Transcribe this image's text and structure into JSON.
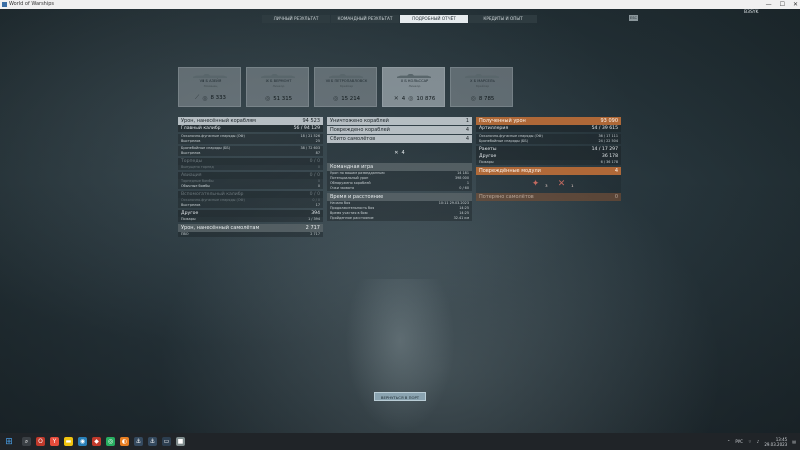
{
  "window": {
    "title": "World of Warships",
    "minimize": "—",
    "maximize": "☐",
    "close": "✕"
  },
  "tabs": [
    {
      "label": "ЛИЧНЫЙ РЕЗУЛЬТАТ"
    },
    {
      "label": "КОМАНДНЫЙ РЕЗУЛЬТАТ"
    },
    {
      "label": "ПОДРОБНЫЙ ОТЧЁТ"
    },
    {
      "label": "КРЕДИТЫ И ОПЫТ"
    }
  ],
  "exit_label": "ESC",
  "username": "B3SYK",
  "ships": [
    {
      "name": "Ⅷ Б АЗЕЙЯ",
      "desc": "Эсминец",
      "kills": "",
      "damage": "8 333",
      "icon": "torpedo-icon"
    },
    {
      "name": "Ⅸ Б ВЕРМОНТ",
      "desc": "Линкор",
      "kills": "",
      "damage": "51 315",
      "icon": "binoculars-icon"
    },
    {
      "name": "Ⅶ Б ПЕТРОПАВЛОВСК",
      "desc": "Крейсер",
      "kills": "",
      "damage": "15 214",
      "icon": "binoculars-icon"
    },
    {
      "name": "Ⅹ Б КОЛЬССАР",
      "desc": "Линкор",
      "kills": "4",
      "damage": "10 876",
      "icon": "binoculars-icon"
    },
    {
      "name": "Ⅹ Б МАРСЕЛЬ",
      "desc": "Крейсер",
      "kills": "",
      "damage": "8 785",
      "icon": "binoculars-icon"
    }
  ],
  "left": {
    "damage_ships": {
      "label": "Урон, нанесённый кораблям",
      "value": "94 523"
    },
    "main_battery": {
      "label": "Главный калибр",
      "value": "56 / 94 129"
    },
    "he_shells": {
      "label": "Осколочно-фугасные снаряды (ОФ)",
      "value": "18 / 21 526"
    },
    "he_hits": {
      "label": "Выстрелов",
      "value": "25"
    },
    "ap_shells": {
      "label": "Бронебойные снаряды (ББ)",
      "value": "38 / 72 603"
    },
    "ap_hits": {
      "label": "Выстрелов",
      "value": "87"
    },
    "torpedoes": {
      "label": "Торпеды",
      "value": "0 / 0"
    },
    "torpedoes_sub": {
      "label": "Выпущено торпед",
      "value": "0"
    },
    "aviation": {
      "label": "Авиация",
      "value": "0 / 0"
    },
    "aviation_a": {
      "label": "Торпедные бомбы",
      "value": "0"
    },
    "aviation_b": {
      "label": "Обычные бомбы",
      "value": "0"
    },
    "secondary": {
      "label": "Вспомогательный калибр",
      "value": "0 / 0"
    },
    "secondary_a": {
      "label": "Осколочно-фугасные снаряды (ОФ)",
      "value": "0 / 0"
    },
    "secondary_b": {
      "label": "Выстрелов",
      "value": "17"
    },
    "other": {
      "label": "Другое",
      "value": "394"
    },
    "fires": {
      "label": "Пожары",
      "value": "1 / 394"
    },
    "damage_planes": {
      "label": "Урон, нанесённый самолётам",
      "value": "2 717"
    },
    "aa": {
      "label": "ПВО",
      "value": "2 717"
    }
  },
  "middle": {
    "destroyed_ships": {
      "label": "Уничтожено кораблей",
      "value": "1"
    },
    "damaged_ships": {
      "label": "Повреждено кораблей",
      "value": "4"
    },
    "shot_planes": {
      "label": "Сбито самолётов",
      "value": "4"
    },
    "center_count": "4",
    "team": {
      "label": "Командная игра"
    },
    "team_rows": [
      {
        "label": "Урон по вашим разведданным",
        "value": "14 181"
      },
      {
        "label": "Потенциальный урон",
        "value": "398 000"
      },
      {
        "label": "Обнаружено кораблей",
        "value": "1"
      },
      {
        "label": "Очки захвата",
        "value": "0 / 60"
      }
    ],
    "time": {
      "label": "Время и расстояние"
    },
    "time_rows": [
      {
        "label": "Начало боя",
        "value": "10:11  29.03.2023"
      },
      {
        "label": "Продолжительность боя",
        "value": "14:25"
      },
      {
        "label": "Время участия в бою",
        "value": "14:25"
      },
      {
        "label": "Пройденное расстояние",
        "value": "32.41 км"
      }
    ]
  },
  "right": {
    "received": {
      "label": "Полученный урон",
      "value": "93 090"
    },
    "artillery": {
      "label": "Артиллерия",
      "value": "54 / 39 615"
    },
    "he_a": {
      "label": "Осколочно-фугасные снаряды (ОФ)",
      "value": "36 / 17 111"
    },
    "ap_a": {
      "label": "Бронебойные снаряды (ББ)",
      "value": "24 / 22 504"
    },
    "rockets": {
      "label": "Ракеты",
      "value": "14 / 17 297"
    },
    "other": {
      "label": "Другое",
      "value": "36 178"
    },
    "fires": {
      "label": "Пожары",
      "value": "6 / 36 178"
    },
    "medals": {
      "label": "Повреждённые модули",
      "value": "4"
    },
    "ribbon_1": "3",
    "ribbon_2": "1",
    "lost_planes": {
      "label": "Потеряно самолётов",
      "value": "0"
    }
  },
  "return_button": "ВЕРНУТЬСЯ В ПОРТ",
  "taskbar": {
    "time": "13:45",
    "date": "29.03.2023",
    "lang": "РУС"
  }
}
